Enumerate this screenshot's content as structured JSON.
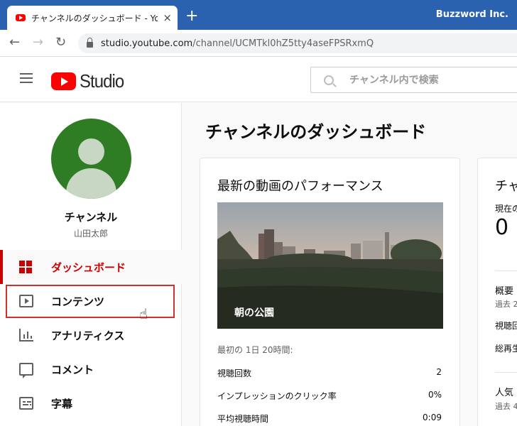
{
  "browser": {
    "tab_title": "チャンネルのダッシュボード - YouTube Studio",
    "tab_close": "×",
    "new_tab": "+",
    "profile": "Buzzword Inc.",
    "nav": {
      "back": "←",
      "forward": "→",
      "reload": "↻"
    },
    "url_host": "studio.youtube.com",
    "url_path": "/channel/UCMTkl0hZ5tty4aseFPSRxmQ"
  },
  "header": {
    "logo_text": "Studio",
    "search_placeholder": "チャンネル内で検索"
  },
  "channel": {
    "name": "チャンネル",
    "owner": "山田太郎"
  },
  "sidebar": {
    "items": [
      {
        "label": "ダッシュボード"
      },
      {
        "label": "コンテンツ"
      },
      {
        "label": "アナリティクス"
      },
      {
        "label": "コメント"
      },
      {
        "label": "字幕"
      }
    ]
  },
  "main": {
    "page_title": "チャンネルのダッシュボード",
    "performance": {
      "title": "最新の動画のパフォーマンス",
      "video_title": "朝の公園",
      "period": "最初の 1日 20時間:",
      "stats": [
        {
          "label": "視聴回数",
          "value": "2"
        },
        {
          "label": "インプレッションのクリック率",
          "value": "0%"
        },
        {
          "label": "平均視聴時間",
          "value": "0:09"
        }
      ]
    },
    "side_card": {
      "title_partial": "チャ",
      "current_partial": "現在の",
      "subscribers": "0",
      "summary_partial": "概要",
      "period_partial": "過去 2",
      "views_partial": "視聴回",
      "watch_partial": "総再生",
      "popular_partial": "人気",
      "period2_partial": "過去 4"
    }
  },
  "colors": {
    "accent": "#cc0000",
    "chrome": "#2a62b0",
    "avatar": "#2e7d24"
  }
}
